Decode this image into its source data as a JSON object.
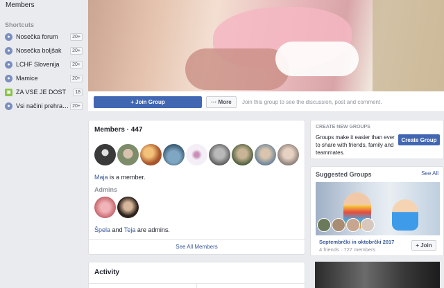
{
  "sidebar": {
    "members_label": "Members",
    "shortcuts_label": "Shortcuts",
    "items": [
      {
        "label": "Nosečka forum",
        "badge": "20+",
        "icon": "group-icon"
      },
      {
        "label": "Nosečka boljšak",
        "badge": "20+",
        "icon": "group-icon"
      },
      {
        "label": "LCHF Slovenija",
        "badge": "20+",
        "icon": "group-icon"
      },
      {
        "label": "Mamice",
        "badge": "20+",
        "icon": "group-icon"
      },
      {
        "label": "ZA VSE JE DOST",
        "badge": "18",
        "icon": "page-icon"
      },
      {
        "label": "Vsi načini prehrane...",
        "badge": "20+",
        "icon": "group-icon"
      }
    ]
  },
  "actionbar": {
    "join_label": "+ Join Group",
    "more_label": "··· More",
    "note": "Join this group to see the discussion, post and comment."
  },
  "members": {
    "title": "Members · 447",
    "member_name": "Maja",
    "member_suffix": " is a member.",
    "admins_title": "Admins",
    "admin_1": "Špela",
    "admin_and": " and ",
    "admin_2": "Teja",
    "admin_suffix": " are admins.",
    "see_all": "See All Members",
    "avatar_colors": [
      "#3a3a3a",
      "#9b8b7a",
      "#d98a3a",
      "#6f8ea8",
      "#e9e3f0",
      "#7a7a7a",
      "#5d6b4a",
      "#8fa3b5",
      "#b0a39a"
    ],
    "admin_avatar_colors": [
      "#d77a82",
      "#3b2a22"
    ]
  },
  "activity": {
    "title": "Activity"
  },
  "create_group": {
    "label": "CREATE NEW GROUPS",
    "text": "Groups make it easier than ever to share with friends, family and teammates.",
    "button": "Create Group"
  },
  "suggested": {
    "title": "Suggested Groups",
    "see_all": "See All",
    "group_name": "Septembrčki in oktobrčki 2017",
    "group_meta": "4 friends · 727 members",
    "join_label": "+ Join"
  }
}
